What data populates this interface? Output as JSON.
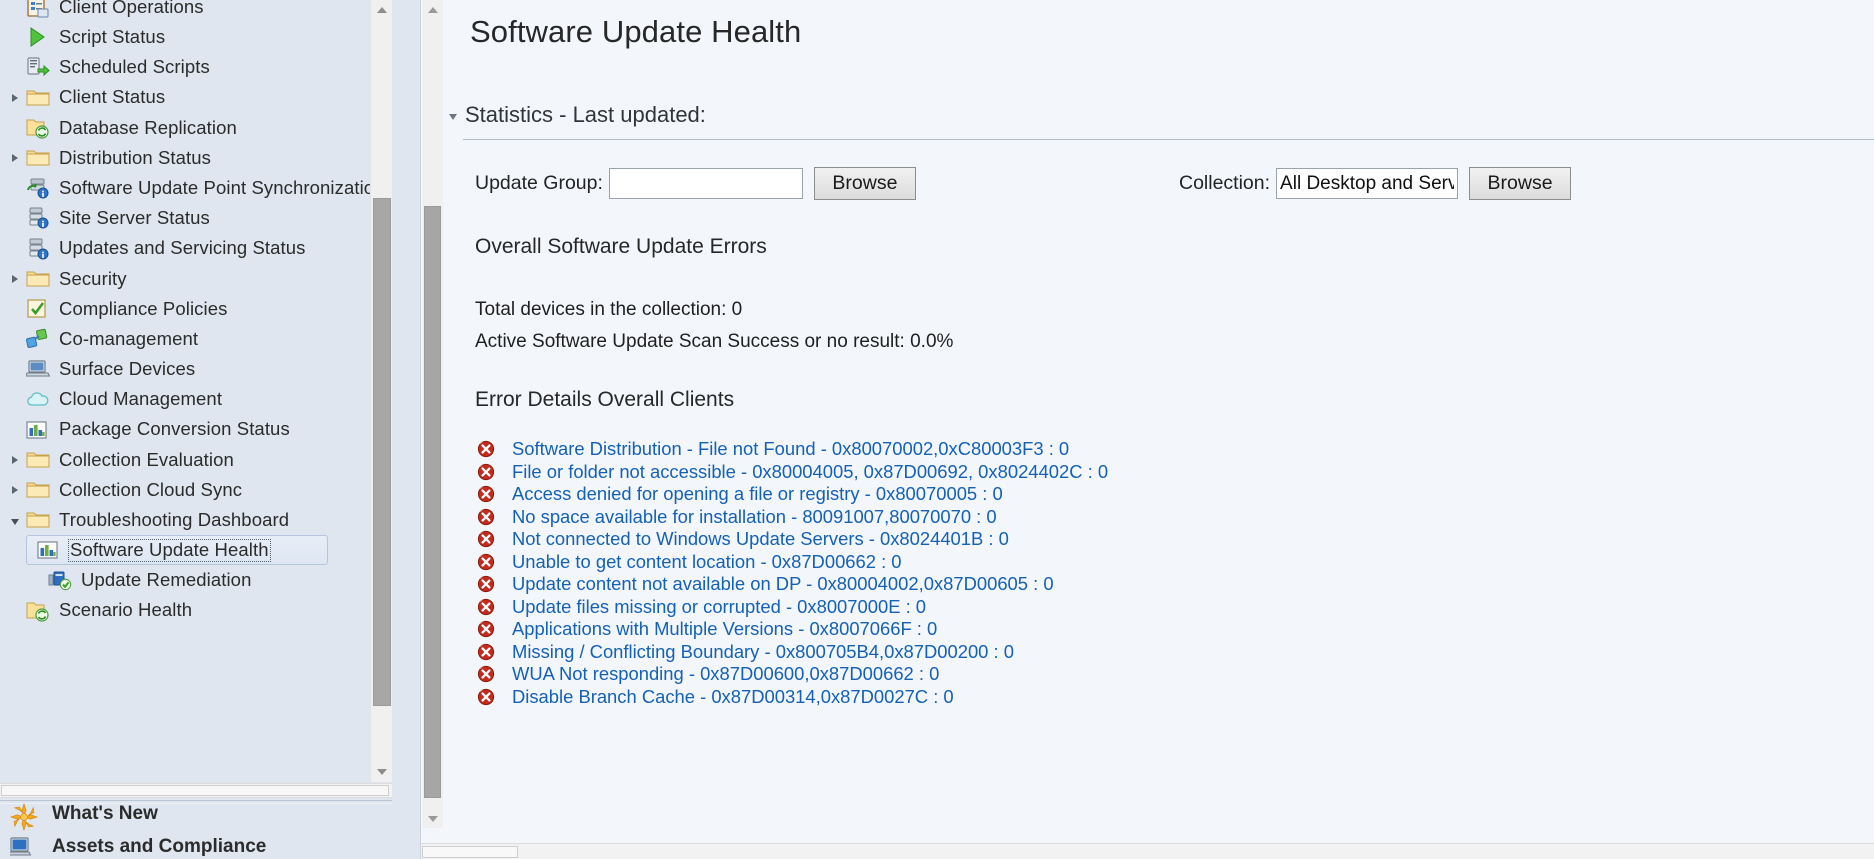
{
  "sidebar": {
    "tree_items": [
      {
        "label": "Client Operations",
        "icon": "client-operations-icon",
        "indent": 1,
        "twisty": "none",
        "selected": false
      },
      {
        "label": "Script Status",
        "icon": "script-status-icon",
        "indent": 1,
        "twisty": "none",
        "selected": false
      },
      {
        "label": "Scheduled Scripts",
        "icon": "scheduled-scripts-icon",
        "indent": 1,
        "twisty": "none",
        "selected": false
      },
      {
        "label": "Client Status",
        "icon": "folder-icon",
        "indent": 0,
        "twisty": "closed",
        "selected": false
      },
      {
        "label": "Database Replication",
        "icon": "database-replication-icon",
        "indent": 1,
        "twisty": "none",
        "selected": false
      },
      {
        "label": "Distribution Status",
        "icon": "folder-icon",
        "indent": 0,
        "twisty": "closed",
        "selected": false
      },
      {
        "label": "Software Update Point Synchronization Sta",
        "icon": "sync-status-icon",
        "indent": 1,
        "twisty": "none",
        "selected": false
      },
      {
        "label": "Site Server Status",
        "icon": "site-server-icon",
        "indent": 1,
        "twisty": "none",
        "selected": false
      },
      {
        "label": "Updates and Servicing Status",
        "icon": "site-server-icon",
        "indent": 1,
        "twisty": "none",
        "selected": false
      },
      {
        "label": "Security",
        "icon": "folder-icon",
        "indent": 0,
        "twisty": "closed",
        "selected": false
      },
      {
        "label": "Compliance Policies",
        "icon": "compliance-policies-icon",
        "indent": 1,
        "twisty": "none",
        "selected": false
      },
      {
        "label": "Co-management",
        "icon": "co-management-icon",
        "indent": 1,
        "twisty": "none",
        "selected": false
      },
      {
        "label": "Surface Devices",
        "icon": "surface-devices-icon",
        "indent": 1,
        "twisty": "none",
        "selected": false
      },
      {
        "label": "Cloud Management",
        "icon": "cloud-icon",
        "indent": 1,
        "twisty": "none",
        "selected": false
      },
      {
        "label": "Package Conversion Status",
        "icon": "bar-chart-icon",
        "indent": 1,
        "twisty": "none",
        "selected": false
      },
      {
        "label": "Collection Evaluation",
        "icon": "folder-icon",
        "indent": 0,
        "twisty": "closed",
        "selected": false
      },
      {
        "label": "Collection Cloud Sync",
        "icon": "folder-icon",
        "indent": 0,
        "twisty": "closed",
        "selected": false
      },
      {
        "label": "Troubleshooting Dashboard",
        "icon": "folder-icon",
        "indent": 0,
        "twisty": "open",
        "selected": false
      },
      {
        "label": "Software Update Health",
        "icon": "bar-chart-icon",
        "indent": 2,
        "twisty": "none",
        "selected": true
      },
      {
        "label": "Update Remediation",
        "icon": "update-remediation-icon",
        "indent": 2,
        "twisty": "none",
        "selected": false
      },
      {
        "label": "Scenario Health",
        "icon": "database-replication-icon",
        "indent": 1,
        "twisty": "none",
        "selected": false
      }
    ],
    "nav_items": [
      {
        "label": "What's New",
        "icon": "whats-new-icon"
      },
      {
        "label": "Assets and Compliance",
        "icon": "assets-and-compliance-icon"
      }
    ]
  },
  "main": {
    "page_title": "Software Update Health",
    "section": {
      "title": "Statistics - Last updated:",
      "twisty_icon": "chevron-down-icon"
    },
    "form": {
      "update_group": {
        "label": "Update Group:",
        "value": "",
        "placeholder": "",
        "browse_label": "Browse"
      },
      "collection": {
        "label": "Collection:",
        "value": "All Desktop and Serv",
        "placeholder": "",
        "browse_label": "Browse"
      }
    },
    "overall": {
      "heading": "Overall Software Update Errors",
      "total_devices": "Total devices in the collection: 0",
      "scan_success": "Active Software Update Scan Success or no result: 0.0%"
    },
    "errors": {
      "heading": "Error Details Overall Clients",
      "icon": "error-icon",
      "items": [
        "Software Distribution - File not Found - 0x80070002,0xC80003F3 : 0",
        "File or folder not accessible - 0x80004005, 0x87D00692, 0x8024402C : 0",
        "Access denied for opening a file or registry - 0x80070005 : 0",
        "No space available for installation - 80091007,80070070 : 0",
        "Not connected to Windows Update Servers - 0x8024401B  : 0",
        "Unable to get content location - 0x87D00662  : 0",
        "Update content not available on DP - 0x80004002,0x87D00605 : 0",
        "Update files missing or corrupted - 0x8007000E : 0",
        "Applications with Multiple Versions - 0x8007066F : 0",
        "Missing / Conflicting Boundary - 0x800705B4,0x87D00200 : 0",
        "WUA Not responding - 0x87D00600,0x87D00662 : 0",
        "Disable Branch Cache - 0x87D00314,0x87D0027C : 0"
      ]
    }
  },
  "colors": {
    "sidebar_bg": "#dfe6ef",
    "main_bg": "#f3f6fb",
    "link": "#1461b5",
    "error_red": "#c42b1c",
    "folder": "#f7d486",
    "selected_border": "#b4c6dd"
  }
}
